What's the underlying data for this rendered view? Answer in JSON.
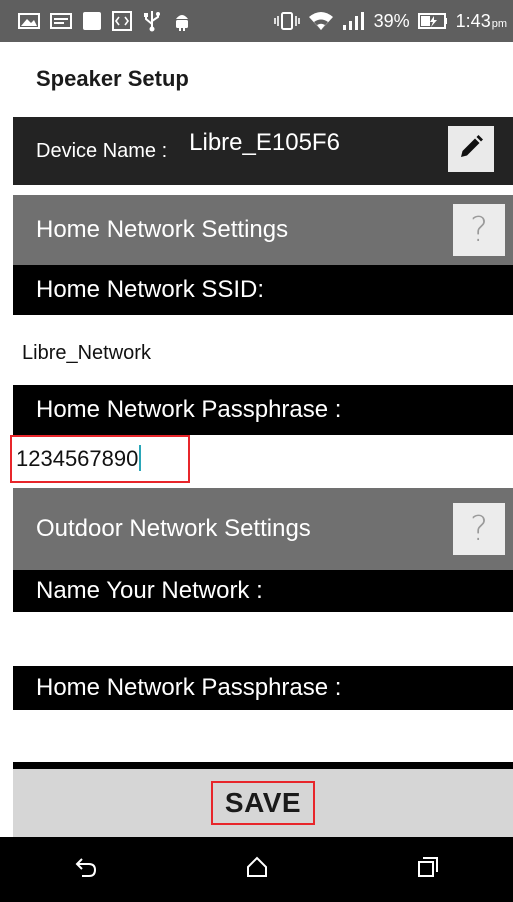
{
  "status_bar": {
    "battery_percent": "39%",
    "time": "1:43",
    "ampm": "pm",
    "icons": [
      "gallery-icon",
      "message-icon",
      "notification-icon",
      "code-icon",
      "usb-icon",
      "android-debug-icon",
      "vibrate-icon",
      "wifi-icon",
      "signal-icon",
      "battery-icon"
    ]
  },
  "page": {
    "title": "Speaker Setup"
  },
  "device": {
    "label": "Device Name :",
    "value": "Libre_E105F6",
    "edit_icon": "pencil-icon"
  },
  "home_network": {
    "heading": "Home Network Settings",
    "help_glyph": "?",
    "ssid_label": "Home Network SSID:",
    "ssid_value": "Libre_Network",
    "pass_label": "Home Network Passphrase :",
    "pass_value": "1234567890"
  },
  "outdoor_network": {
    "heading": "Outdoor Network Settings",
    "help_glyph": "?",
    "name_label": "Name Your Network :",
    "name_value": "",
    "pass_label": "Home Network Passphrase :",
    "pass_value": ""
  },
  "actions": {
    "save_label": "SAVE"
  },
  "nav": {
    "icons": [
      "back-icon",
      "home-icon",
      "recents-icon"
    ]
  },
  "colors": {
    "status_bar": "#5f5f5f",
    "dark_row": "#232323",
    "black_row": "#000000",
    "gray_row": "#707070",
    "highlight": "#e8262b",
    "caret": "#2aa6b8",
    "save_bar": "#d6d6d6"
  }
}
